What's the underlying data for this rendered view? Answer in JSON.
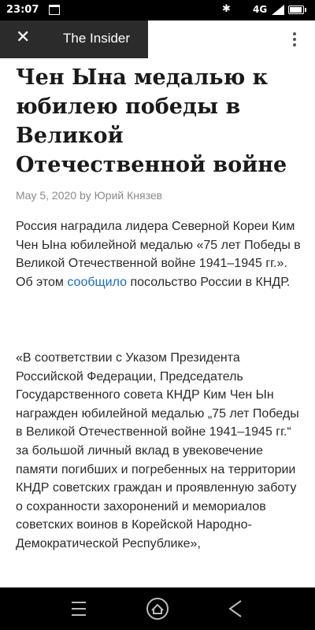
{
  "status_bar": {
    "time": "23:07",
    "network": "4G",
    "network_sup": "4G"
  },
  "toolbar": {
    "title": "The Insider",
    "close_icon": "close-icon",
    "menu_icon": "more-vert-icon"
  },
  "article": {
    "headline": "Чен Ына медалью к юбилею победы в Великой Отечественной войне",
    "date": "May 5, 2020",
    "by": "by",
    "author": "Юрий Князев",
    "p1_before": "Россия наградила лидера Северной Кореи Ким Чен Ына юбилейной медалью «75 лет Победы в Великой Отечественной войне 1941–1945 гг.». Об этом ",
    "p1_link": "сообщило",
    "p1_after": " посольство России в КНДР.",
    "p2": "«В соответствии с Указом Президента Российской Федерации, Председатель Государственного совета КНДР Ким Чен Ын награжден юбилейной медалью „75 лет Победы в Великой Отечественной войне 1941–1945 гг.“ за большой личный вклад в увековечение памяти погибших и погребенных на территории КНДР советских граждан и проявленную заботу о сохранности захоронений и мемориалов советских воинов в Корейской Народно-Демократической Республике»,"
  },
  "nav": {
    "menu": "☰",
    "home": "⌂",
    "back": "‹"
  },
  "colors": {
    "link": "#1a6cbf",
    "toolbar": "#2b2b2b"
  }
}
